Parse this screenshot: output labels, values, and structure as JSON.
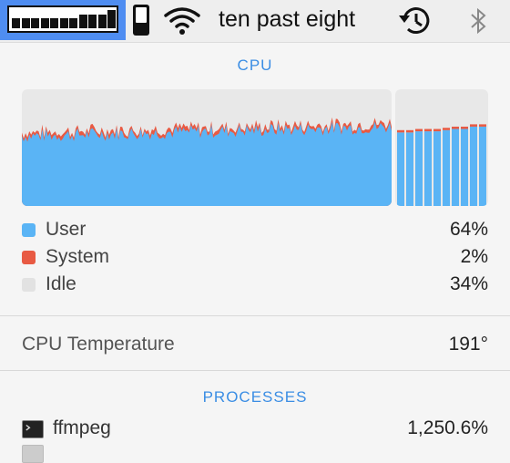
{
  "menubar": {
    "clock_text": "ten past eight",
    "cpu_meter_levels": [
      0.5,
      0.5,
      0.5,
      0.5,
      0.5,
      0.5,
      0.5,
      0.7,
      0.7,
      0.7,
      0.9
    ],
    "battery_level": 0.3,
    "icons": [
      "cpu-meter-icon",
      "battery-icon",
      "wifi-icon",
      "time-machine-icon",
      "bluetooth-icon"
    ]
  },
  "cpu": {
    "header": "CPU",
    "legend": [
      {
        "label": "User",
        "value": "64%",
        "color": "#5ab4f5"
      },
      {
        "label": "System",
        "value": "2%",
        "color": "#e85a43"
      },
      {
        "label": "Idle",
        "value": "34%",
        "color": "#e6e6e6"
      }
    ],
    "history_user": [
      0.63,
      0.63,
      0.64,
      0.64,
      0.64,
      0.65,
      0.66,
      0.66,
      0.68,
      0.68
    ],
    "history_system": [
      0.02,
      0.02,
      0.02,
      0.02,
      0.02,
      0.02,
      0.02,
      0.02,
      0.02,
      0.02
    ]
  },
  "temperature": {
    "label": "CPU Temperature",
    "value": "191°"
  },
  "processes": {
    "header": "PROCESSES",
    "items": [
      {
        "name": "ffmpeg",
        "value": "1,250.6%"
      }
    ]
  }
}
